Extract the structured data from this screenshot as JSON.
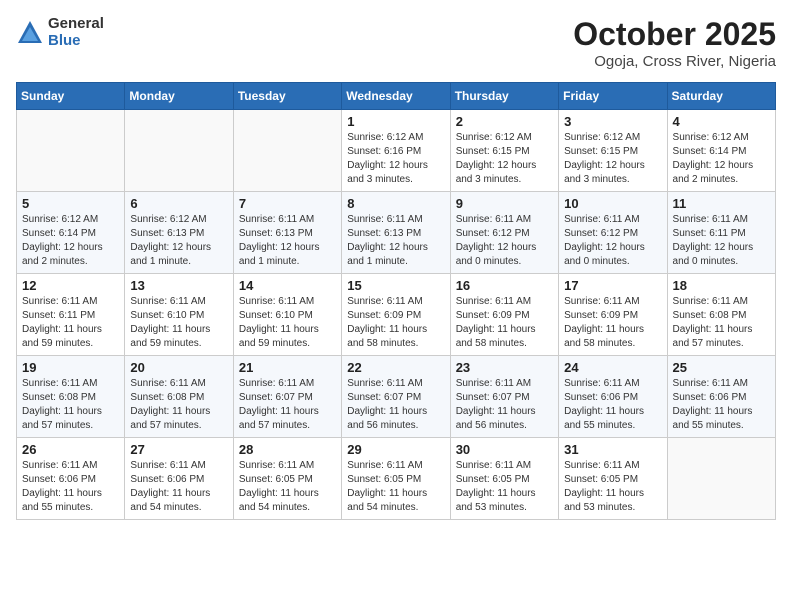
{
  "logo": {
    "general": "General",
    "blue": "Blue"
  },
  "title": {
    "month": "October 2025",
    "location": "Ogoja, Cross River, Nigeria"
  },
  "weekdays": [
    "Sunday",
    "Monday",
    "Tuesday",
    "Wednesday",
    "Thursday",
    "Friday",
    "Saturday"
  ],
  "weeks": [
    [
      {
        "day": "",
        "info": ""
      },
      {
        "day": "",
        "info": ""
      },
      {
        "day": "",
        "info": ""
      },
      {
        "day": "1",
        "info": "Sunrise: 6:12 AM\nSunset: 6:16 PM\nDaylight: 12 hours\nand 3 minutes."
      },
      {
        "day": "2",
        "info": "Sunrise: 6:12 AM\nSunset: 6:15 PM\nDaylight: 12 hours\nand 3 minutes."
      },
      {
        "day": "3",
        "info": "Sunrise: 6:12 AM\nSunset: 6:15 PM\nDaylight: 12 hours\nand 3 minutes."
      },
      {
        "day": "4",
        "info": "Sunrise: 6:12 AM\nSunset: 6:14 PM\nDaylight: 12 hours\nand 2 minutes."
      }
    ],
    [
      {
        "day": "5",
        "info": "Sunrise: 6:12 AM\nSunset: 6:14 PM\nDaylight: 12 hours\nand 2 minutes."
      },
      {
        "day": "6",
        "info": "Sunrise: 6:12 AM\nSunset: 6:13 PM\nDaylight: 12 hours\nand 1 minute."
      },
      {
        "day": "7",
        "info": "Sunrise: 6:11 AM\nSunset: 6:13 PM\nDaylight: 12 hours\nand 1 minute."
      },
      {
        "day": "8",
        "info": "Sunrise: 6:11 AM\nSunset: 6:13 PM\nDaylight: 12 hours\nand 1 minute."
      },
      {
        "day": "9",
        "info": "Sunrise: 6:11 AM\nSunset: 6:12 PM\nDaylight: 12 hours\nand 0 minutes."
      },
      {
        "day": "10",
        "info": "Sunrise: 6:11 AM\nSunset: 6:12 PM\nDaylight: 12 hours\nand 0 minutes."
      },
      {
        "day": "11",
        "info": "Sunrise: 6:11 AM\nSunset: 6:11 PM\nDaylight: 12 hours\nand 0 minutes."
      }
    ],
    [
      {
        "day": "12",
        "info": "Sunrise: 6:11 AM\nSunset: 6:11 PM\nDaylight: 11 hours\nand 59 minutes."
      },
      {
        "day": "13",
        "info": "Sunrise: 6:11 AM\nSunset: 6:10 PM\nDaylight: 11 hours\nand 59 minutes."
      },
      {
        "day": "14",
        "info": "Sunrise: 6:11 AM\nSunset: 6:10 PM\nDaylight: 11 hours\nand 59 minutes."
      },
      {
        "day": "15",
        "info": "Sunrise: 6:11 AM\nSunset: 6:09 PM\nDaylight: 11 hours\nand 58 minutes."
      },
      {
        "day": "16",
        "info": "Sunrise: 6:11 AM\nSunset: 6:09 PM\nDaylight: 11 hours\nand 58 minutes."
      },
      {
        "day": "17",
        "info": "Sunrise: 6:11 AM\nSunset: 6:09 PM\nDaylight: 11 hours\nand 58 minutes."
      },
      {
        "day": "18",
        "info": "Sunrise: 6:11 AM\nSunset: 6:08 PM\nDaylight: 11 hours\nand 57 minutes."
      }
    ],
    [
      {
        "day": "19",
        "info": "Sunrise: 6:11 AM\nSunset: 6:08 PM\nDaylight: 11 hours\nand 57 minutes."
      },
      {
        "day": "20",
        "info": "Sunrise: 6:11 AM\nSunset: 6:08 PM\nDaylight: 11 hours\nand 57 minutes."
      },
      {
        "day": "21",
        "info": "Sunrise: 6:11 AM\nSunset: 6:07 PM\nDaylight: 11 hours\nand 57 minutes."
      },
      {
        "day": "22",
        "info": "Sunrise: 6:11 AM\nSunset: 6:07 PM\nDaylight: 11 hours\nand 56 minutes."
      },
      {
        "day": "23",
        "info": "Sunrise: 6:11 AM\nSunset: 6:07 PM\nDaylight: 11 hours\nand 56 minutes."
      },
      {
        "day": "24",
        "info": "Sunrise: 6:11 AM\nSunset: 6:06 PM\nDaylight: 11 hours\nand 55 minutes."
      },
      {
        "day": "25",
        "info": "Sunrise: 6:11 AM\nSunset: 6:06 PM\nDaylight: 11 hours\nand 55 minutes."
      }
    ],
    [
      {
        "day": "26",
        "info": "Sunrise: 6:11 AM\nSunset: 6:06 PM\nDaylight: 11 hours\nand 55 minutes."
      },
      {
        "day": "27",
        "info": "Sunrise: 6:11 AM\nSunset: 6:06 PM\nDaylight: 11 hours\nand 54 minutes."
      },
      {
        "day": "28",
        "info": "Sunrise: 6:11 AM\nSunset: 6:05 PM\nDaylight: 11 hours\nand 54 minutes."
      },
      {
        "day": "29",
        "info": "Sunrise: 6:11 AM\nSunset: 6:05 PM\nDaylight: 11 hours\nand 54 minutes."
      },
      {
        "day": "30",
        "info": "Sunrise: 6:11 AM\nSunset: 6:05 PM\nDaylight: 11 hours\nand 53 minutes."
      },
      {
        "day": "31",
        "info": "Sunrise: 6:11 AM\nSunset: 6:05 PM\nDaylight: 11 hours\nand 53 minutes."
      },
      {
        "day": "",
        "info": ""
      }
    ]
  ]
}
